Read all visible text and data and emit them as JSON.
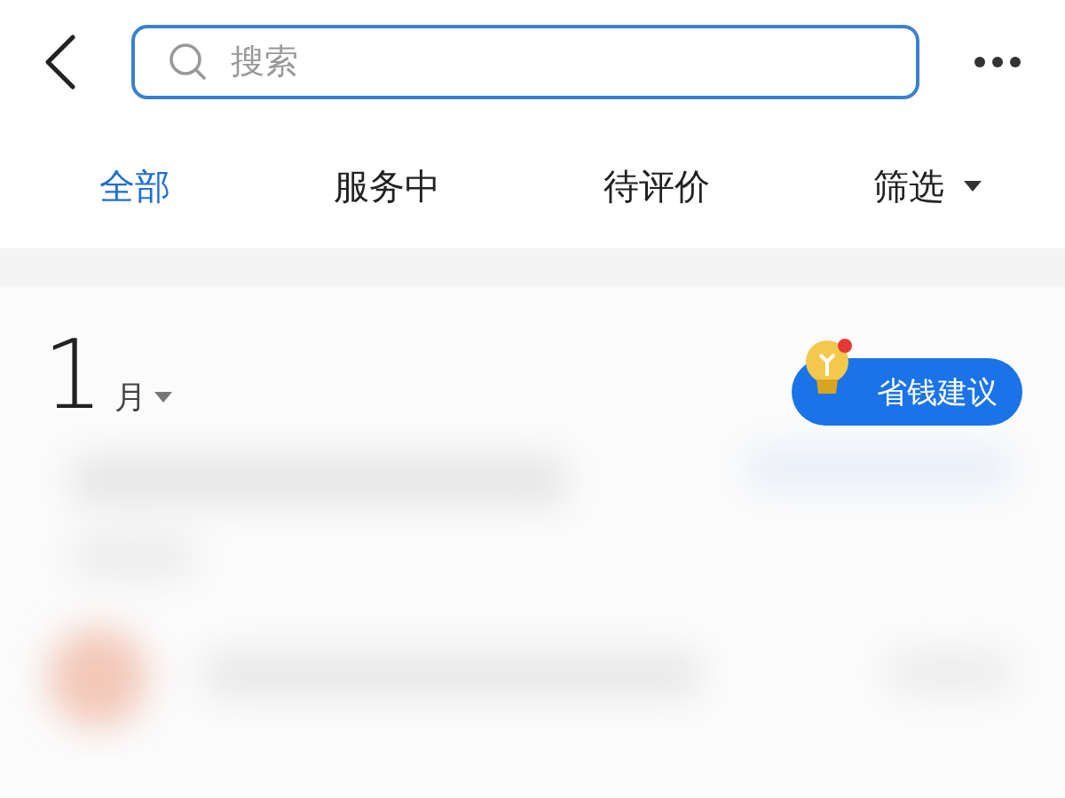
{
  "search": {
    "placeholder": "搜索"
  },
  "tabs": [
    {
      "label": "全部",
      "selected": true
    },
    {
      "label": "服务中",
      "selected": false
    },
    {
      "label": "待评价",
      "selected": false
    }
  ],
  "filter": {
    "label": "筛选"
  },
  "month": {
    "number": "1",
    "unit": "月"
  },
  "advice_button": {
    "label": "省钱建议",
    "has_dot": true
  }
}
